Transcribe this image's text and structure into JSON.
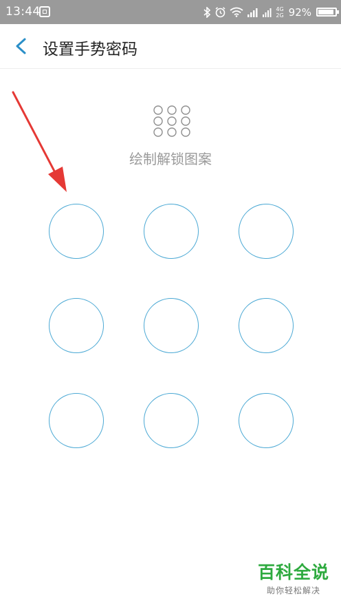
{
  "status_bar": {
    "time": "13:44",
    "network_top": "4G",
    "network_bottom": "2G",
    "battery_percent": "92%",
    "battery_level": 0.92
  },
  "header": {
    "title": "设置手势密码"
  },
  "prompt": {
    "text": "绘制解锁图案"
  },
  "lock_pattern": {
    "dots": [
      1,
      2,
      3,
      4,
      5,
      6,
      7,
      8,
      9
    ],
    "color": "#4aa8d4"
  },
  "annotation": {
    "arrow_color": "#e53935"
  },
  "watermark": {
    "title": "百科全说",
    "subtitle": "助你轻松解决"
  }
}
